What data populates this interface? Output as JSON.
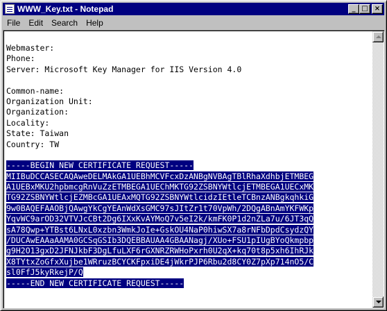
{
  "window": {
    "title": "WWW_Key.txt - Notepad"
  },
  "menu": [
    "File",
    "Edit",
    "Search",
    "Help"
  ],
  "text_lines": [
    {
      "text": "Webmaster:",
      "selected": false
    },
    {
      "text": "Phone:",
      "selected": false
    },
    {
      "text": "Server: Microsoft Key Manager for IIS Version 4.0",
      "selected": false
    },
    {
      "text": "",
      "selected": false
    },
    {
      "text": "Common-name:",
      "selected": false
    },
    {
      "text": "Organization Unit:",
      "selected": false
    },
    {
      "text": "Organization:",
      "selected": false
    },
    {
      "text": "Locality:",
      "selected": false
    },
    {
      "text": "State: Taiwan",
      "selected": false
    },
    {
      "text": "Country: TW",
      "selected": false
    },
    {
      "text": "",
      "selected": false
    },
    {
      "text": "-----BEGIN NEW CERTIFICATE REQUEST-----",
      "selected": true
    },
    {
      "text": "MIIBuDCCASECAQAweDELMAkGA1UEBhMCVFcxDzANBgNVBAgTBlRhaXdhbjETMBEG",
      "selected": true
    },
    {
      "text": "A1UEBxMKU2hpbmcgRnVuZzETMBEGA1UEChMKTG92ZSBNYWtlcjETMBEGA1UECxMK",
      "selected": true
    },
    {
      "text": "TG92ZSBNYWtlcjEZMBcGA1UEAxMQTG92ZSBNYWtlcidzIEtleTCBnzANBgkqhkiG",
      "selected": true
    },
    {
      "text": "9w0BAQEFAAOBjQAwgYkCgYEAnWdXsGMC97sJItZr1t70VpWh/2DQgABnAmYKFWKp",
      "selected": true
    },
    {
      "text": "YqvWC9arOD32VTVJcCBt2Dg6IXxKvAYMoQ7v5eI2k/kmFK0P1d2nZLa7u/6JT3qQ",
      "selected": true
    },
    {
      "text": "sA78Qwp+YTBst6LNxL0xzbn3WmkJoIe+GskOU4NaP0hiwSX7a8rNFbDpdCsydzQY",
      "selected": true
    },
    {
      "text": "/DUCAwEAAaAAMA0GCSqGSIb3DQEBBAUAA4GBAANagj/XUo+FSU1pIUgBYoQkmpbp",
      "selected": true
    },
    {
      "text": "g9H2O13gxD2JFNJkbF3DgLfuLXF6rGXNRZRWHoPxrh0U2qX+kq70t8p5xh6IhRJk",
      "selected": true
    },
    {
      "text": "X8TYtxZoGfxXujbe1WRruzBCYCKFpxiDE4jWkrPJP6Rbu2d8CY0Z7pXp714nO5/C",
      "selected": true
    },
    {
      "text": "sl0FfJ5kyRkejP/Q",
      "selected": true
    },
    {
      "text": "-----END NEW CERTIFICATE REQUEST-----",
      "selected": true
    }
  ],
  "icons": {
    "app": "notepad-icon",
    "minimize": "minimize-icon",
    "maximize": "maximize-icon",
    "close": "close-icon"
  },
  "colors": {
    "titlebar": "#000080",
    "selection": "#000080",
    "desktop": "#008080"
  }
}
